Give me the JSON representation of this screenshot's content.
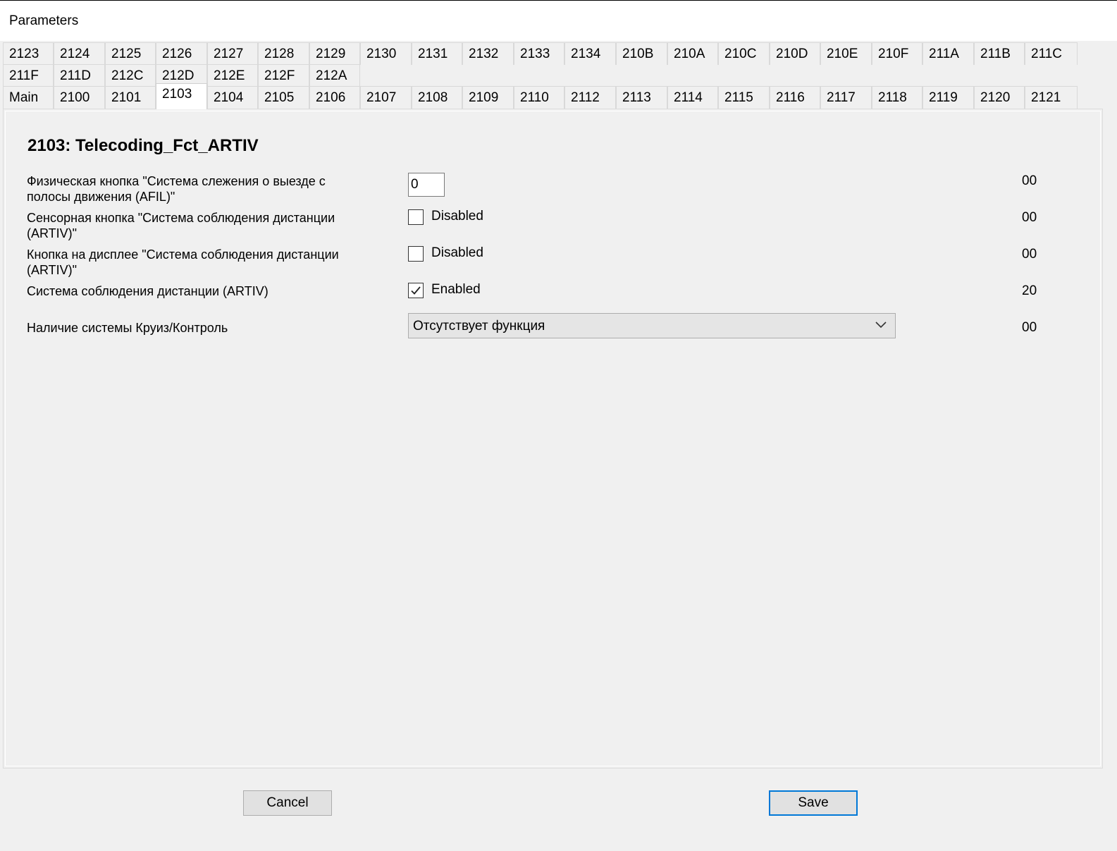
{
  "window": {
    "title": "Parameters"
  },
  "tabs": {
    "row1": [
      "2123",
      "2124",
      "2125",
      "2126",
      "2127",
      "2128",
      "2129",
      "2130",
      "2131",
      "2132",
      "2133",
      "2134",
      "210B",
      "210A",
      "210C",
      "210D",
      "210E",
      "210F",
      "211A",
      "211B",
      "211C"
    ],
    "row2": [
      "211F",
      "211D",
      "212C",
      "212D",
      "212E",
      "212F",
      "212A"
    ],
    "row3": [
      "Main",
      "2100",
      "2101",
      "2103",
      "2104",
      "2105",
      "2106",
      "2107",
      "2108",
      "2109",
      "2110",
      "2112",
      "2113",
      "2114",
      "2115",
      "2116",
      "2117",
      "2118",
      "2119",
      "2120",
      "2121"
    ],
    "active": "2103"
  },
  "section": {
    "title": "2103: Telecoding_Fct_ARTIV"
  },
  "params": {
    "p1": {
      "label": "Физическая кнопка \"Система слежения о выезде с полосы движения (AFIL)\"",
      "input_value": "0",
      "value": "00"
    },
    "p2": {
      "label": "Сенсорная кнопка \"Система соблюдения дистанции (ARTIV)\"",
      "checkbox_label": "Disabled",
      "checked": false,
      "value": "00"
    },
    "p3": {
      "label": "Кнопка на дисплее \"Система соблюдения дистанции (ARTIV)\"",
      "checkbox_label": "Disabled",
      "checked": false,
      "value": "00"
    },
    "p4": {
      "label": "Система соблюдения дистанции (ARTIV)",
      "checkbox_label": "Enabled",
      "checked": true,
      "value": "20"
    },
    "p5": {
      "label": "Наличие системы Круиз/Контроль",
      "selected": "Отсутствует функция",
      "value": "00"
    }
  },
  "buttons": {
    "cancel": "Cancel",
    "save": "Save"
  },
  "colors": {
    "accent": "#0078d7",
    "tab_border": "#d9d9d9",
    "panel_bg": "#f0f0f0"
  },
  "icons": {
    "checkmark": "check-icon",
    "dropdown": "chevron-down-icon"
  }
}
